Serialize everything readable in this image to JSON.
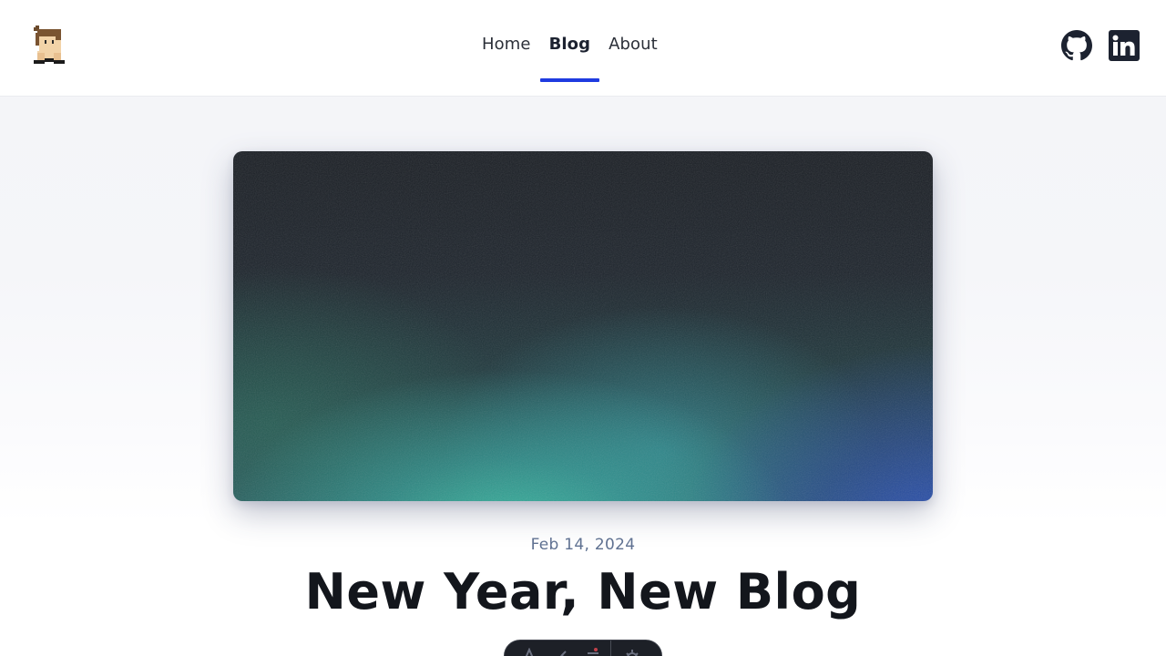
{
  "nav": {
    "items": [
      {
        "label": "Home",
        "active": false
      },
      {
        "label": "Blog",
        "active": true
      },
      {
        "label": "About",
        "active": false
      }
    ],
    "accent_color": "#1f3be0"
  },
  "social": {
    "github": {
      "icon": "github-icon"
    },
    "linkedin": {
      "icon": "linkedin-icon"
    }
  },
  "logo": {
    "icon": "pixel-avatar-logo"
  },
  "post": {
    "date": "Feb 14, 2024",
    "title": "New Year, New Blog"
  },
  "toolbar": {
    "buttons": [
      {
        "icon": "text-icon"
      },
      {
        "icon": "brush-icon"
      },
      {
        "icon": "menu-icon"
      },
      {
        "icon": "settings-icon"
      }
    ]
  }
}
